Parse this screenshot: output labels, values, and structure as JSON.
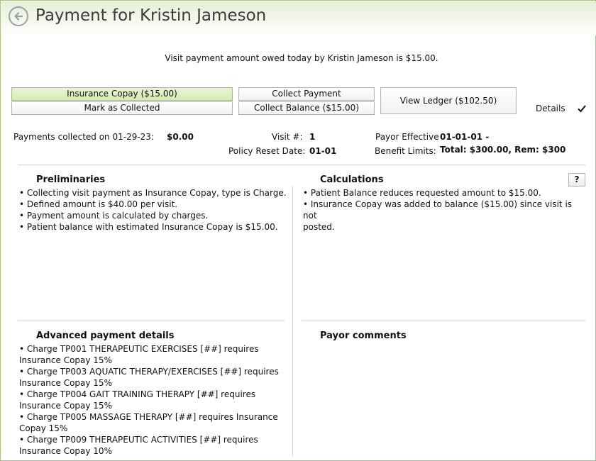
{
  "header": {
    "title": "Payment for Kristin Jameson"
  },
  "summary": {
    "owed_text": "Visit payment amount owed today by Kristin Jameson is $15.00."
  },
  "buttons": {
    "insurance_copay": "Insurance Copay ($15.00)",
    "mark_collected": "Mark as Collected",
    "collect_payment": "Collect Payment",
    "collect_balance": "Collect Balance ($15.00)",
    "view_ledger": "View Ledger ($102.50)",
    "help": "?"
  },
  "details": {
    "label": "Details",
    "checked": true
  },
  "info": {
    "payments_label": "Payments collected on 01-29-23:",
    "payments_value": "$0.00",
    "visit_label": "Visit #:",
    "visit_value": "1",
    "policy_label": "Policy Reset Date:",
    "policy_value": "01-01",
    "payor_label": "Payor Effective",
    "payor_value": "01-01-01 -",
    "benefit_label": "Benefit Limits:",
    "benefit_value": "Total: $300.00, Rem: $300"
  },
  "sections": {
    "preliminaries": {
      "title": "Preliminaries",
      "items": [
        "• Collecting visit payment as Insurance Copay, type is Charge.",
        "• Defined amount is $40.00 per visit.",
        "• Payment amount is calculated by charges.",
        "• Patient balance with estimated Insurance Copay is $15.00."
      ]
    },
    "calculations": {
      "title": "Calculations",
      "items": [
        "• Patient Balance reduces requested amount to $15.00.",
        "• Insurance Copay was added to balance ($15.00) since visit is not",
        "posted."
      ]
    },
    "advanced": {
      "title": "Advanced payment details",
      "items": [
        "• Charge TP001 THERAPEUTIC EXERCISES [##] requires",
        "Insurance Copay 15%",
        "• Charge TP003 AQUATIC THERAPY/EXERCISES [##] requires",
        "Insurance Copay 15%",
        "• Charge TP004 GAIT TRAINING THERAPY [##] requires",
        "Insurance Copay 15%",
        "• Charge TP005 MASSAGE THERAPY [##] requires Insurance",
        "Copay 15%",
        "• Charge TP009 THERAPEUTIC ACTIVITIES [##] requires",
        "Insurance Copay 10%"
      ]
    },
    "payor_comments": {
      "title": "Payor comments"
    }
  }
}
